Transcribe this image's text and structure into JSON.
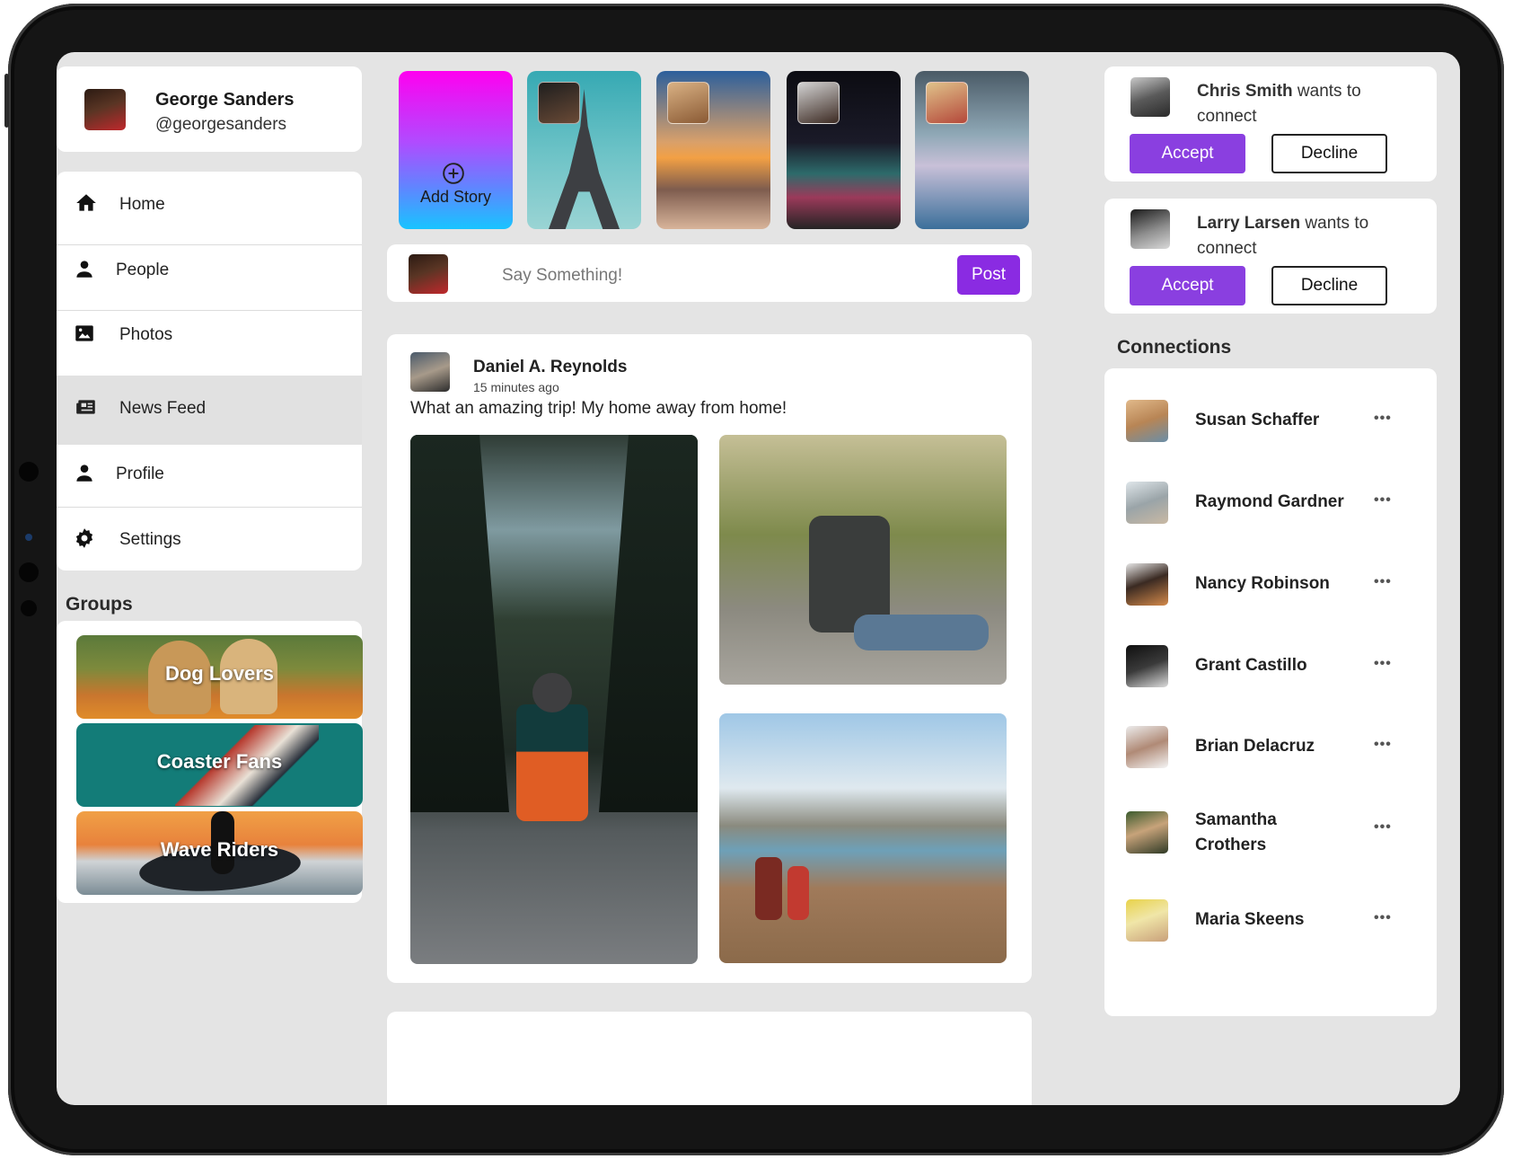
{
  "profile": {
    "name": "George Sanders",
    "handle": "@georgesanders"
  },
  "nav": {
    "items": [
      {
        "label": "Home",
        "icon": "home-icon"
      },
      {
        "label": "People",
        "icon": "person-icon"
      },
      {
        "label": "Photos",
        "icon": "image-icon"
      },
      {
        "label": "News Feed",
        "icon": "newspaper-icon",
        "active": true
      },
      {
        "label": "Profile",
        "icon": "person-icon"
      },
      {
        "label": "Settings",
        "icon": "gear-icon"
      }
    ]
  },
  "groups": {
    "title": "Groups",
    "items": [
      {
        "label": "Dog Lovers"
      },
      {
        "label": "Coaster Fans"
      },
      {
        "label": "Wave Riders"
      }
    ]
  },
  "stories": {
    "add_label": "Add Story"
  },
  "composer": {
    "placeholder": "Say Something!",
    "post_label": "Post"
  },
  "post": {
    "author": "Daniel A. Reynolds",
    "time": "15 minutes ago",
    "text": "What an amazing trip! My home away from home!"
  },
  "requests": [
    {
      "name": "Chris Smith",
      "text": " wants to connect",
      "accept": "Accept",
      "decline": "Decline"
    },
    {
      "name": "Larry Larsen",
      "text": " wants to connect",
      "accept": "Accept",
      "decline": "Decline"
    }
  ],
  "connections": {
    "title": "Connections",
    "more": "•••",
    "items": [
      {
        "name": "Susan Schaffer"
      },
      {
        "name": "Raymond Gardner"
      },
      {
        "name": "Nancy Robinson"
      },
      {
        "name": "Grant Castillo"
      },
      {
        "name": "Brian Delacruz"
      },
      {
        "name": "Samantha Crothers"
      },
      {
        "name": "Maria Skeens"
      }
    ]
  },
  "colors": {
    "accent": "#8a3fe0",
    "background": "#e4e4e4",
    "card": "#ffffff"
  }
}
